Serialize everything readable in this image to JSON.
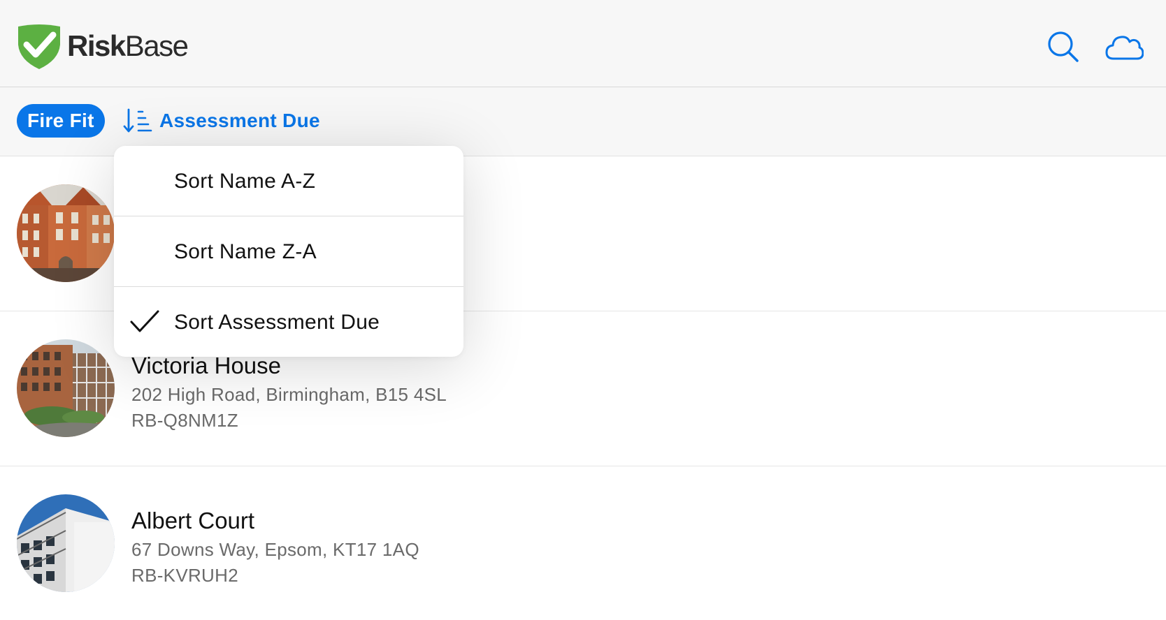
{
  "app": {
    "brand_bold": "Risk",
    "brand_regular": "Base",
    "accent_color": "#0a76e8",
    "logo_color": "#5cb042",
    "icons": [
      "shield-check-logo",
      "search-icon",
      "cloud-icon",
      "sort-icon",
      "checkmark-icon"
    ]
  },
  "toolbar": {
    "filter_chip": "Fire Fit",
    "sort_label": "Assessment Due"
  },
  "sort_menu": {
    "items": [
      {
        "label": "Sort Name A-Z",
        "selected": false
      },
      {
        "label": "Sort Name Z-A",
        "selected": false
      },
      {
        "label": "Sort Assessment Due",
        "selected": true
      }
    ]
  },
  "properties": [
    {
      "name": "",
      "address": "",
      "code": ""
    },
    {
      "name": "Victoria House",
      "address": "202 High Road, Birmingham, B15 4SL",
      "code": "RB-Q8NM1Z"
    },
    {
      "name": "Albert Court",
      "address": "67 Downs Way, Epsom, KT17 1AQ",
      "code": "RB-KVRUH2"
    }
  ]
}
